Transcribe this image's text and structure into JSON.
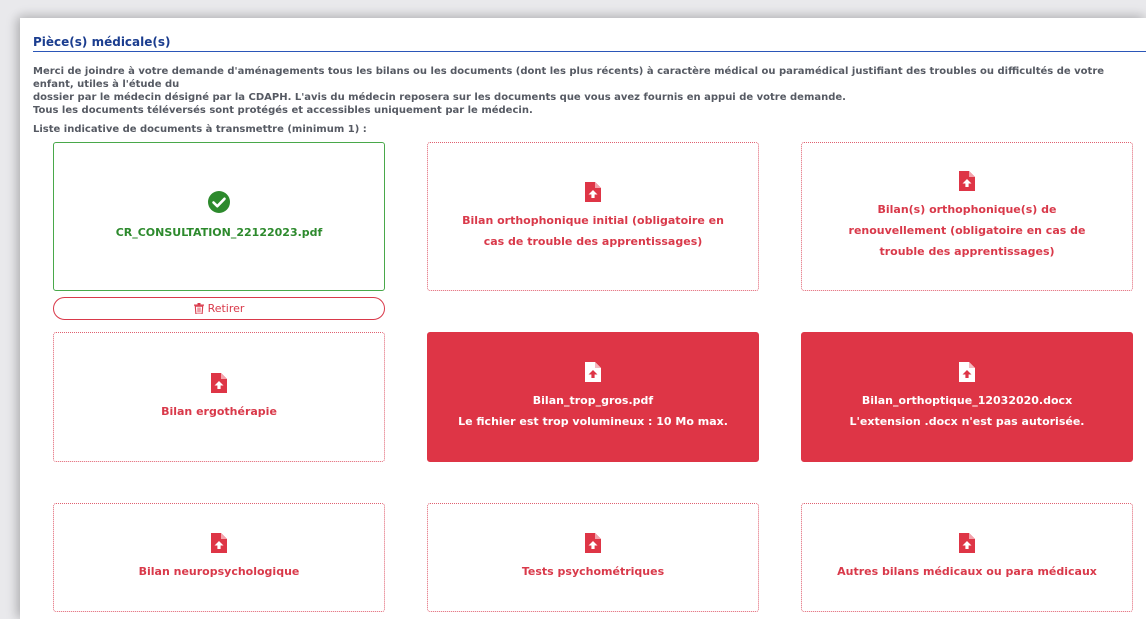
{
  "section": {
    "title": "Pièce(s) médicale(s)",
    "desc_line1": "Merci de joindre à votre demande d'aménagements tous les bilans ou les documents (dont les plus récents) à caractère médical ou paramédical justifiant des troubles ou difficultés de votre enfant, utiles à l'étude du",
    "desc_line2": "dossier par le médecin désigné par la CDAPH. L'avis du médecin reposera sur les documents que vous avez fournis en appui de votre demande.",
    "desc_line3": "Tous les documents téléversés sont protégés et accessibles uniquement par le médecin.",
    "list_label": "Liste indicative de documents à transmettre (minimum 1) :"
  },
  "colors": {
    "accent_blue": "#1b3d8f",
    "error_red": "#de3546",
    "success_green": "#2d8a2d"
  },
  "cards": {
    "uploaded": {
      "filename": "CR_CONSULTATION_22122023.pdf",
      "icon": "check-circle-icon"
    },
    "remove_label": "Retirer",
    "orthophonique_initial": {
      "label": "Bilan orthophonique initial (obligatoire en cas de trouble des apprentissages)",
      "icon": "file-upload-icon"
    },
    "orthophonique_renouvellement": {
      "label": "Bilan(s) orthophonique(s) de renouvellement (obligatoire en cas de trouble des apprentissages)",
      "icon": "file-upload-icon"
    },
    "ergotherapie": {
      "label": "Bilan ergothérapie",
      "icon": "file-upload-icon"
    },
    "error_size": {
      "filename": "Bilan_trop_gros.pdf",
      "error": "Le fichier est trop volumineux : 10 Mo max.",
      "icon": "file-upload-icon"
    },
    "error_ext": {
      "filename": "Bilan_orthoptique_12032020.docx",
      "error": "L'extension .docx n'est pas autorisée.",
      "icon": "file-upload-icon"
    },
    "neuropsy": {
      "label": "Bilan neuropsychologique",
      "icon": "file-upload-icon"
    },
    "psychometriques": {
      "label": "Tests psychométriques",
      "icon": "file-upload-icon"
    },
    "autres": {
      "label": "Autres bilans médicaux ou para médicaux",
      "icon": "file-upload-icon"
    }
  }
}
